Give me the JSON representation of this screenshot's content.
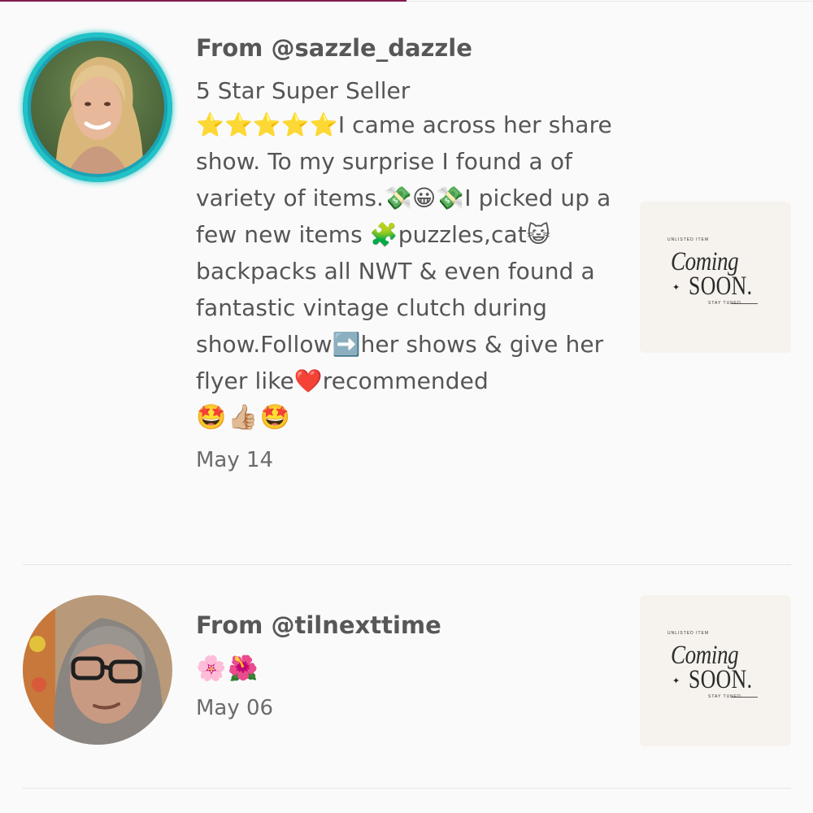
{
  "reviews": [
    {
      "from_label": "From @sazzle_dazzle",
      "title": "5 Star Super Seller",
      "text": "⭐⭐⭐⭐⭐I came across her share show. To my surprise I found a of variety of items.💸😀💸I picked up a few new items 🧩puzzles,cat😺backpacks all NWT & even found a fantastic vintage clutch during show.Follow➡️her shows & give her flyer like❤️recommended",
      "emoji_line": "🤩👍🏼🤩",
      "date": "May 14",
      "avatar_icon": "avatar-woman-blonde",
      "thumbnail": {
        "unlisted": "UNLISTED ITEM",
        "coming": "Coming",
        "soon": "SOON.",
        "stay_tuned": "STAY TUNED"
      }
    },
    {
      "from_label": "From @tilnexttime",
      "emoji_line": "🌸🌺",
      "date": "May 06",
      "avatar_icon": "avatar-woman-glasses",
      "thumbnail": {
        "unlisted": "UNLISTED ITEM",
        "coming": "Coming",
        "soon": "SOON.",
        "stay_tuned": "STAY TUNED"
      }
    }
  ],
  "colors": {
    "background": "#fafafa",
    "accent_top_bar": "#7f1c4e",
    "avatar_ring": "#1fc3c8",
    "text": "#575757",
    "divider": "#e6e6e6"
  }
}
